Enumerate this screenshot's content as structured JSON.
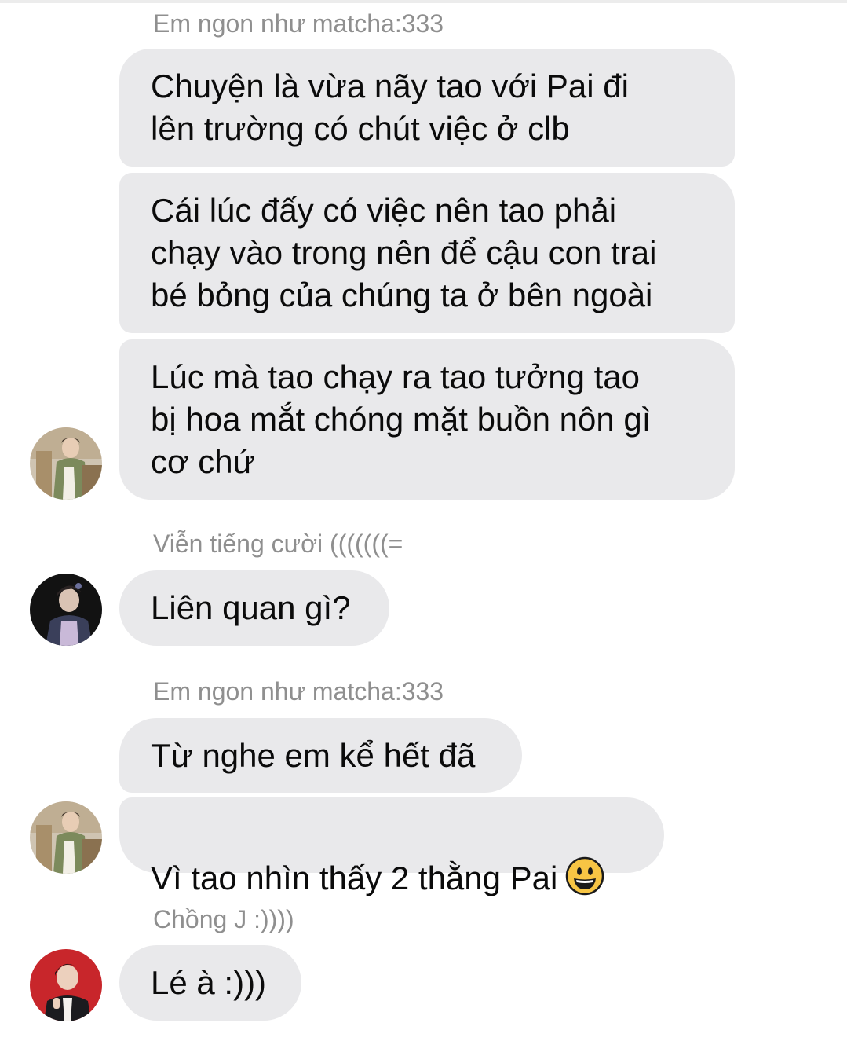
{
  "conversation": {
    "groups": [
      {
        "sender": "Em ngon như matcha:333",
        "messages": [
          "Chuyện là vừa nãy tao với Pai đi\nlên trường có chút việc ở clb",
          "Cái lúc đấy có việc nên tao phải\nchạy vào trong nên để cậu con trai\nbé bỏng của chúng ta ở bên ngoài",
          "Lúc mà tao chạy ra tao tưởng tao\nbị hoa mắt chóng mặt buồn nôn gì\ncơ chứ"
        ]
      },
      {
        "sender": "Viễn tiếng cười (((((((=",
        "messages": [
          "Liên quan gì?"
        ]
      },
      {
        "sender": "Em ngon như matcha:333",
        "messages": [
          "Từ nghe em kể hết đã",
          "Vì tao nhìn thấy 2 thằng Pai"
        ]
      },
      {
        "sender": "Chồng J :))))",
        "messages": [
          "Lé à :)))"
        ]
      }
    ],
    "emoji_icon": "grinning-face-emoji",
    "colors": {
      "bubble": "#e9e9eb",
      "sender_name": "#8f8f8f",
      "text": "#0b0b0b"
    }
  }
}
